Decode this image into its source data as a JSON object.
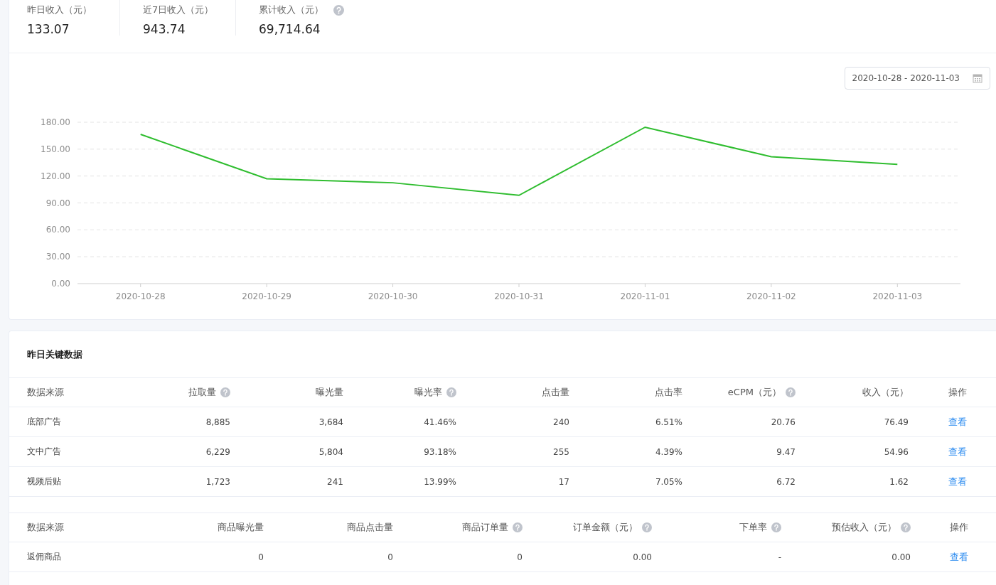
{
  "stats": [
    {
      "label": "昨日收入（元）",
      "value": "133.07",
      "help": false
    },
    {
      "label": "近7日收入（元）",
      "value": "943.74",
      "help": false
    },
    {
      "label": "累计收入（元）",
      "value": "69,714.64",
      "help": true
    }
  ],
  "date_range": {
    "value": "2020-10-28 - 2020-11-03"
  },
  "chart_data": {
    "type": "line",
    "categories": [
      "2020-10-28",
      "2020-10-29",
      "2020-10-30",
      "2020-10-31",
      "2020-11-01",
      "2020-11-02",
      "2020-11-03"
    ],
    "series": [
      {
        "color": "#2fbd2f",
        "values": [
          166.5,
          117,
          112.5,
          98.5,
          174.5,
          141.5,
          133
        ]
      }
    ],
    "grid": true,
    "ylim": [
      0,
      180
    ],
    "yticks": [
      {
        "value": 0,
        "label": "0.00"
      },
      {
        "value": 30,
        "label": "30.00"
      },
      {
        "value": 60,
        "label": "60.00"
      },
      {
        "value": 90,
        "label": "90.00"
      },
      {
        "value": 120,
        "label": "120.00"
      },
      {
        "value": 150,
        "label": "150.00"
      },
      {
        "value": 180,
        "label": "180.00"
      }
    ]
  },
  "key_data": {
    "title": "昨日关键数据",
    "tables": [
      {
        "columns": [
          {
            "label": "数据来源",
            "help": false
          },
          {
            "label": "拉取量",
            "help": true
          },
          {
            "label": "曝光量",
            "help": false
          },
          {
            "label": "曝光率",
            "help": true
          },
          {
            "label": "点击量",
            "help": false
          },
          {
            "label": "点击率",
            "help": false
          },
          {
            "label": "eCPM（元）",
            "help": true
          },
          {
            "label": "收入（元）",
            "help": false
          },
          {
            "label": "操作",
            "help": false
          }
        ],
        "rows": [
          {
            "cells": [
              "底部广告",
              "8,885",
              "3,684",
              "41.46%",
              "240",
              "6.51%",
              "20.76",
              "76.49"
            ],
            "action": "查看"
          },
          {
            "cells": [
              "文中广告",
              "6,229",
              "5,804",
              "93.18%",
              "255",
              "4.39%",
              "9.47",
              "54.96"
            ],
            "action": "查看"
          },
          {
            "cells": [
              "视频后贴",
              "1,723",
              "241",
              "13.99%",
              "17",
              "7.05%",
              "6.72",
              "1.62"
            ],
            "action": "查看"
          }
        ]
      },
      {
        "columns": [
          {
            "label": "数据来源",
            "help": false
          },
          {
            "label": "商品曝光量",
            "help": false
          },
          {
            "label": "商品点击量",
            "help": false
          },
          {
            "label": "商品订单量",
            "help": true
          },
          {
            "label": "订单金额（元）",
            "help": true
          },
          {
            "label": "下单率",
            "help": true
          },
          {
            "label": "预估收入（元）",
            "help": true
          },
          {
            "label": "操作",
            "help": false
          }
        ],
        "rows": [
          {
            "cells": [
              "返佣商品",
              "0",
              "0",
              "0",
              "0.00",
              "-",
              "0.00"
            ],
            "action": "查看"
          }
        ]
      }
    ]
  }
}
